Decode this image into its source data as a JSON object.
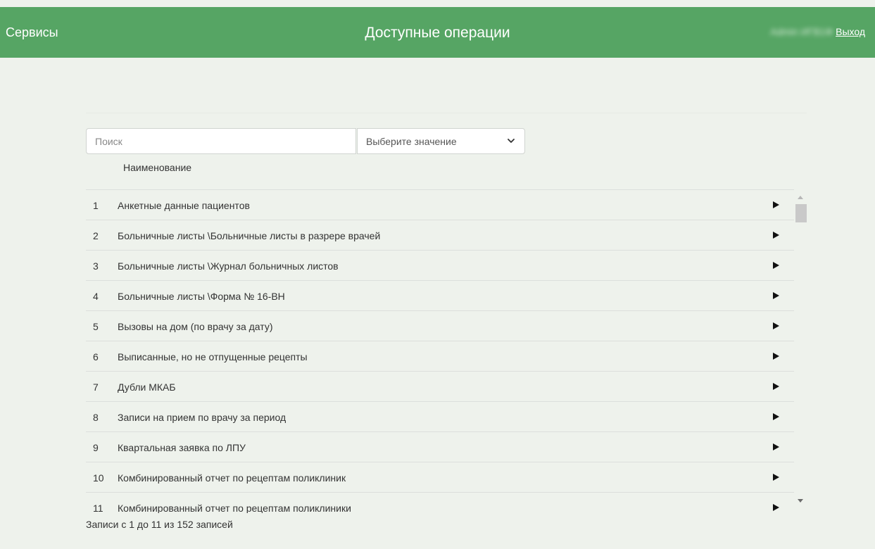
{
  "header": {
    "brand": "Сервисы",
    "title": "Доступные операции",
    "user": "Admin ИГВ1Ф",
    "logout": "Выход"
  },
  "filters": {
    "search_placeholder": "Поиск",
    "select_value": "Выберите значение"
  },
  "table": {
    "column_header": "Наименование",
    "rows": [
      {
        "num": "1",
        "name": "Анкетные данные пациентов"
      },
      {
        "num": "2",
        "name": "Больничные листы \\Больничные листы в разрере врачей"
      },
      {
        "num": "3",
        "name": "Больничные листы \\Журнал больничных листов"
      },
      {
        "num": "4",
        "name": "Больничные листы \\Форма № 16-ВН"
      },
      {
        "num": "5",
        "name": "Вызовы на дом (по врачу за дату)"
      },
      {
        "num": "6",
        "name": "Выписанные, но не отпущенные рецепты"
      },
      {
        "num": "7",
        "name": "Дубли МКАБ"
      },
      {
        "num": "8",
        "name": "Записи на прием по врачу за период"
      },
      {
        "num": "9",
        "name": "Квартальная заявка по ЛПУ"
      },
      {
        "num": "10",
        "name": "Комбинированный отчет по рецептам поликлиник"
      },
      {
        "num": "11",
        "name": "Комбинированный отчет по рецептам поликлиники"
      }
    ]
  },
  "footer": {
    "records_info": "Записи с 1 до 11 из 152 записей"
  },
  "colors": {
    "header_bg": "#56a564",
    "page_bg": "#eef2ec"
  }
}
